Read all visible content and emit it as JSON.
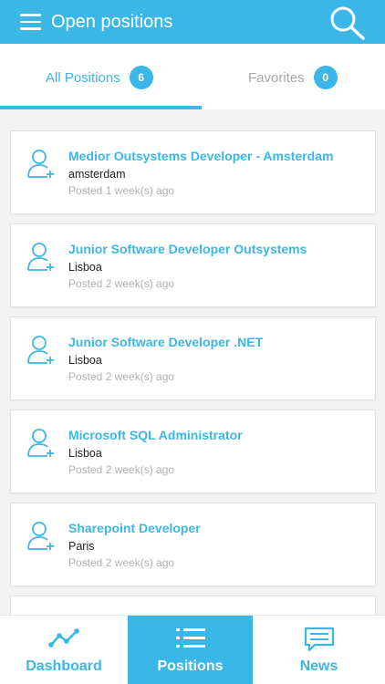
{
  "header": {
    "title": "Open positions",
    "menu_icon": "hamburger-menu-icon",
    "search_icon": "search-icon"
  },
  "tabs": [
    {
      "label": "All Positions",
      "count": "6",
      "active": true
    },
    {
      "label": "Favorites",
      "count": "0",
      "active": false
    }
  ],
  "positions": [
    {
      "title": "Medior Outsystems Developer - Amsterdam",
      "location": "amsterdam",
      "posted": "Posted 1 week(s) ago"
    },
    {
      "title": "Junior Software Developer Outsystems",
      "location": "Lisboa",
      "posted": "Posted 2 week(s) ago"
    },
    {
      "title": "Junior Software Developer .NET",
      "location": "Lisboa",
      "posted": "Posted 2 week(s) ago"
    },
    {
      "title": "Microsoft SQL Administrator",
      "location": "Lisboa",
      "posted": "Posted 2 week(s) ago"
    },
    {
      "title": "Sharepoint Developer",
      "location": "Paris",
      "posted": "Posted 2 week(s) ago"
    },
    {
      "title": "",
      "location": "",
      "posted": ""
    }
  ],
  "bottom_nav": [
    {
      "label": "Dashboard",
      "icon": "trend-line-icon",
      "active": false
    },
    {
      "label": "Positions",
      "icon": "list-icon",
      "active": true
    },
    {
      "label": "News",
      "icon": "chat-bubble-icon",
      "active": false
    }
  ],
  "colors": {
    "accent": "#3ab7e6",
    "background": "#f2f2f2",
    "muted_text": "#b0b0b0"
  }
}
